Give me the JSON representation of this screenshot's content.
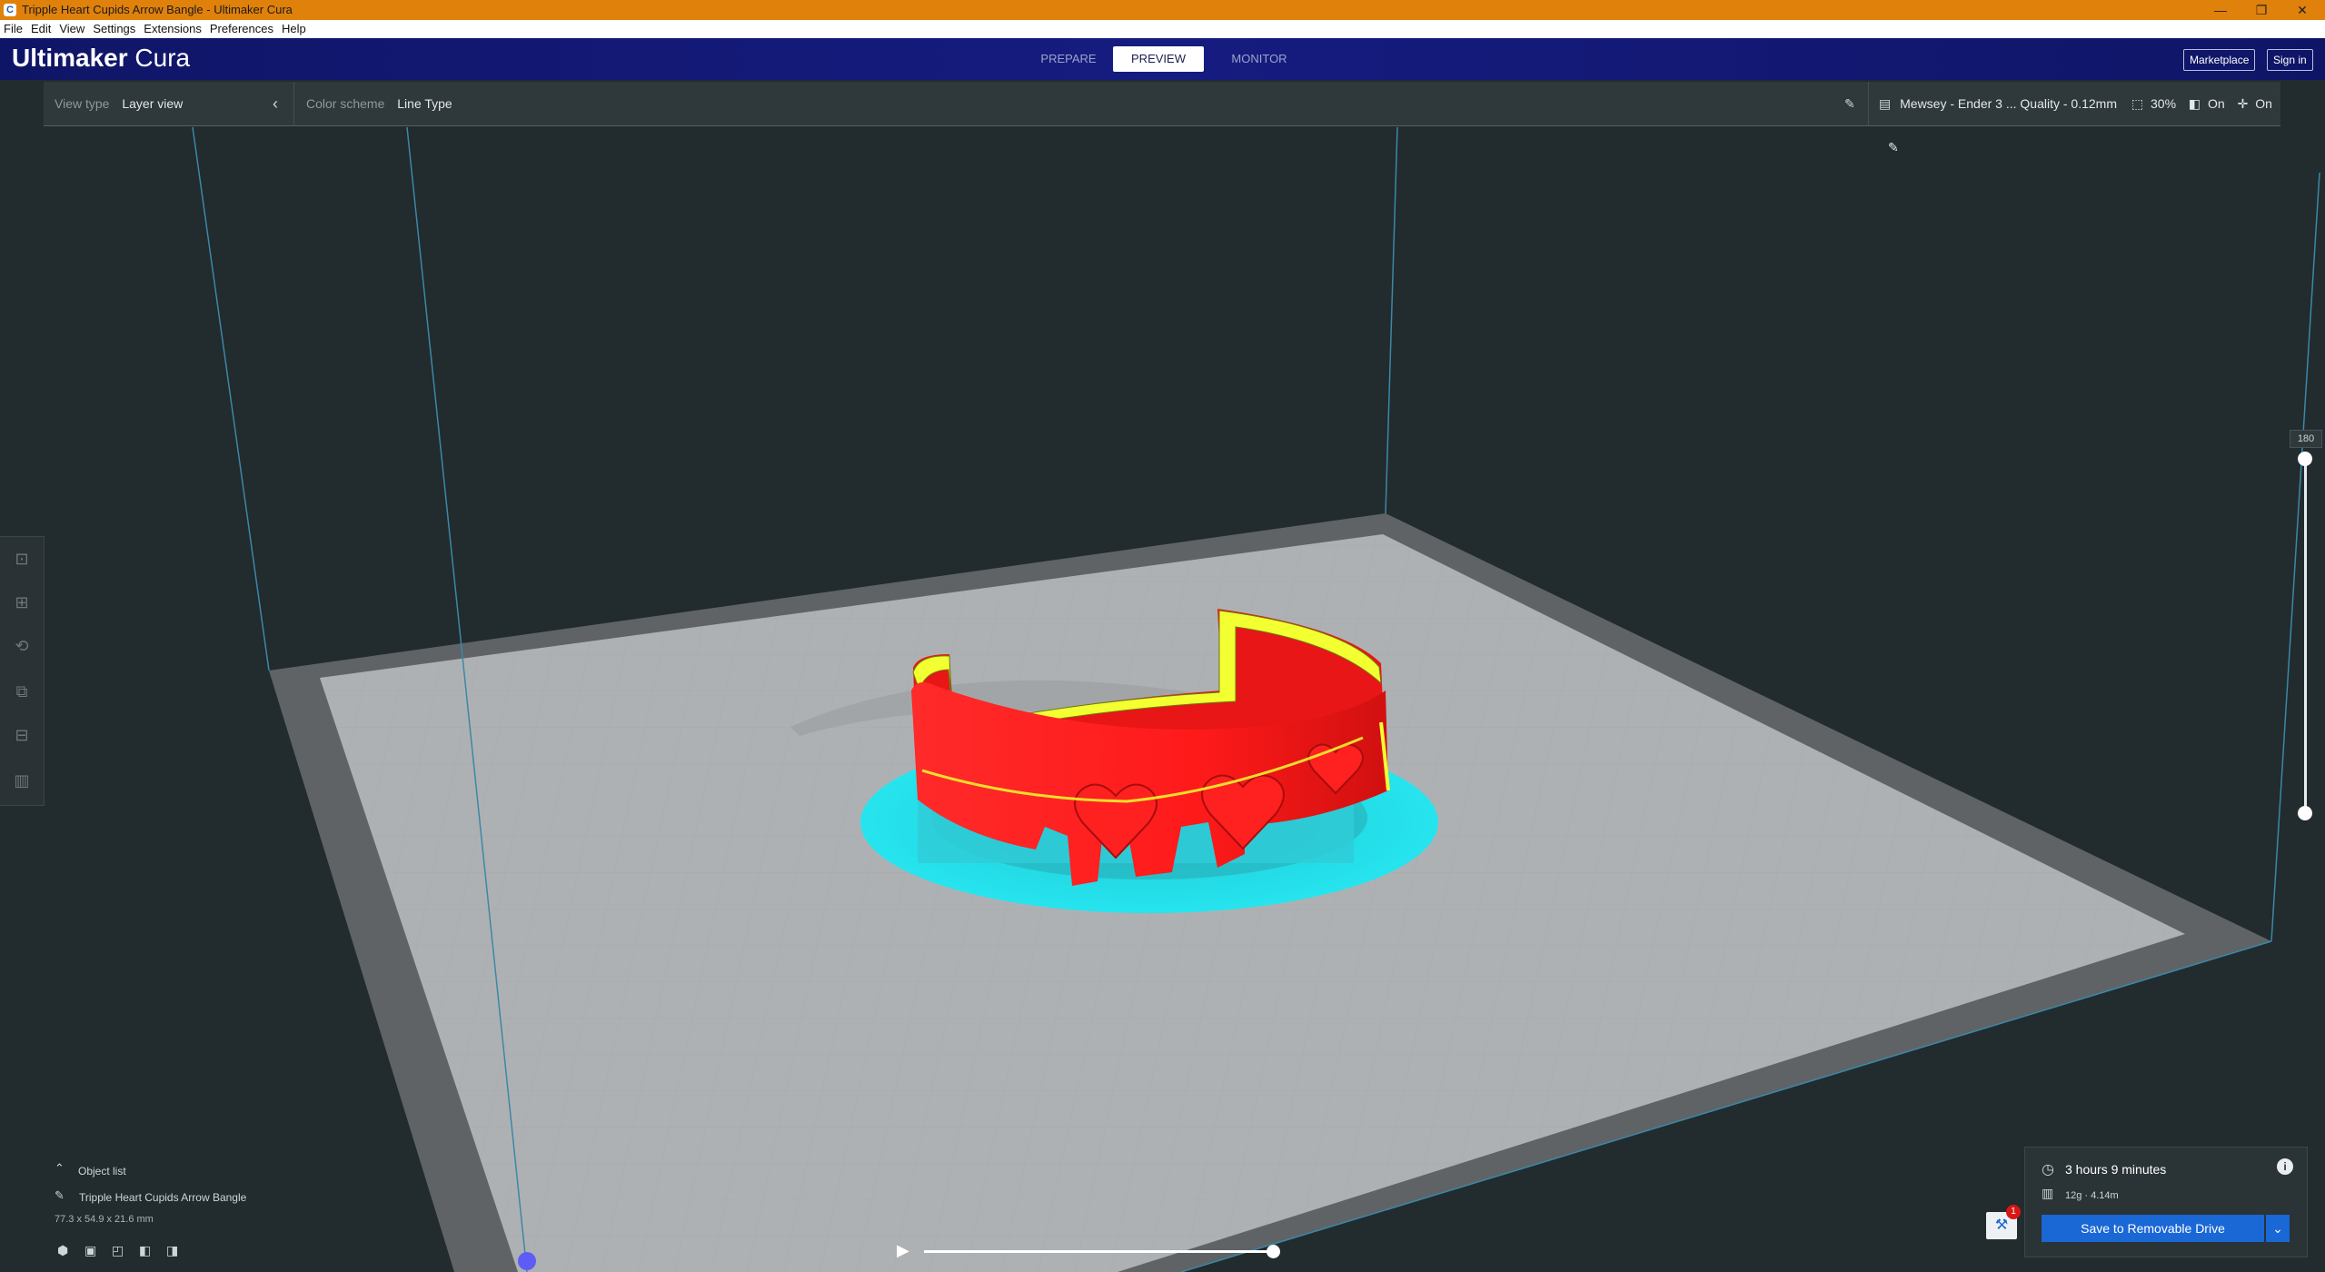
{
  "window": {
    "title": "Tripple Heart Cupids Arrow Bangle - Ultimaker Cura",
    "app_icon": "C",
    "controls": {
      "minimize": "—",
      "restore": "❐",
      "close": "✕"
    }
  },
  "menu": [
    "File",
    "Edit",
    "View",
    "Settings",
    "Extensions",
    "Preferences",
    "Help"
  ],
  "header": {
    "brand_bold": "Ultimaker",
    "brand_light": " Cura",
    "stages": [
      "PREPARE",
      "PREVIEW",
      "MONITOR"
    ],
    "active_stage": "PREVIEW",
    "marketplace": "Marketplace",
    "signin": "Sign in"
  },
  "toolbar": {
    "view_type_label": "View type",
    "view_type_value": "Layer view",
    "color_scheme_label": "Color scheme",
    "color_scheme_value": "Line Type",
    "printer": "Mewsey - Ender 3 ... Quality - 0.12mm",
    "infill": "30%",
    "support": "On",
    "adhesion": "On"
  },
  "layer_slider": {
    "max_layer": "180"
  },
  "object_list": {
    "toggle_label": "Object list",
    "object_name": "Tripple Heart Cupids Arrow Bangle",
    "dimensions": "77.3 x 54.9 x 21.6 mm"
  },
  "estimate": {
    "time": "3 hours 9 minutes",
    "material": "12g · 4.14m",
    "save_label": "Save to Removable Drive",
    "notification_count": "1"
  },
  "colors": {
    "header": "#13167a",
    "accent": "#1a67d6",
    "titlebar": "#e0810b",
    "shell": "#ff1a1a",
    "skirt": "#2be0e8",
    "topskin": "#f4ff2c"
  }
}
